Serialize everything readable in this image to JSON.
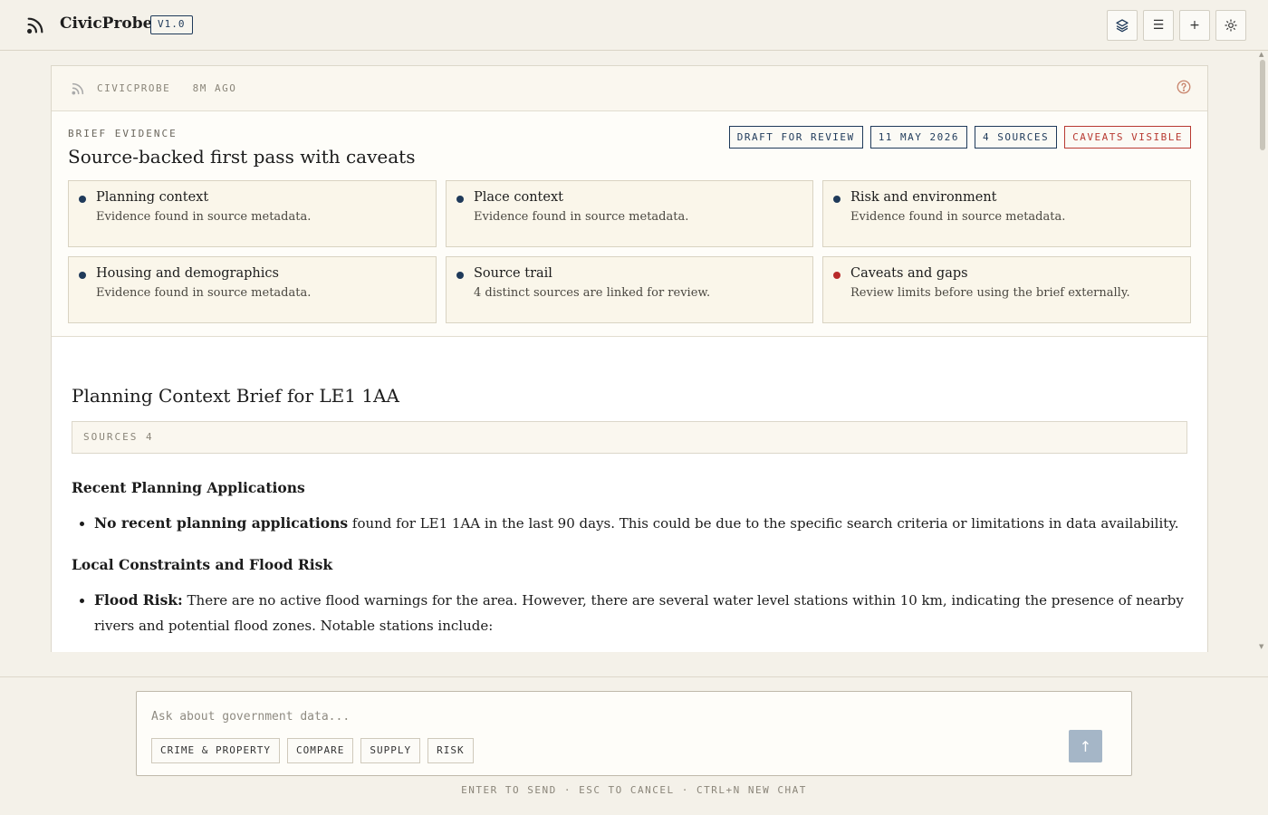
{
  "header": {
    "logo_icon": "rss-feed-icon",
    "app_name": "CivicProbe",
    "version": "V1.0",
    "buttons": [
      {
        "icon": "layers-icon"
      },
      {
        "icon": "menu-icon",
        "glyph": "☰"
      },
      {
        "icon": "plus-icon",
        "glyph": "+"
      },
      {
        "icon": "sun-theme-icon"
      }
    ]
  },
  "panel": {
    "meta": "CIVICPROBE   8M AGO",
    "help_icon": "help-circle-icon"
  },
  "evidence": {
    "label": "BRIEF EVIDENCE",
    "title": "Source-backed first pass with caveats",
    "tags": [
      {
        "label": "DRAFT FOR REVIEW",
        "status": "info"
      },
      {
        "label": "11 MAY 2026",
        "status": "info"
      },
      {
        "label": "4 SOURCES",
        "status": "info"
      },
      {
        "label": "CAVEATS VISIBLE",
        "status": "warn"
      }
    ],
    "cards": [
      {
        "title": "Planning context",
        "sub": "Evidence found in source metadata.",
        "status": "ok"
      },
      {
        "title": "Place context",
        "sub": "Evidence found in source metadata.",
        "status": "ok"
      },
      {
        "title": "Risk and environment",
        "sub": "Evidence found in source metadata.",
        "status": "ok"
      },
      {
        "title": "Housing and demographics",
        "sub": "Evidence found in source metadata.",
        "status": "ok"
      },
      {
        "title": "Source trail",
        "sub": "4 distinct sources are linked for review.",
        "status": "ok"
      },
      {
        "title": "Caveats and gaps",
        "sub": "Review limits before using the brief externally.",
        "status": "warn"
      }
    ]
  },
  "brief": {
    "title": "Planning Context Brief for LE1 1AA",
    "sources": "SOURCES 4",
    "sections": [
      {
        "heading": "Recent Planning Applications",
        "bold": "No recent planning applications",
        "text": " found for LE1 1AA in the last 90 days. This could be due to the specific search criteria or limitations in data availability."
      },
      {
        "heading": "Local Constraints and Flood Risk",
        "bold": "Flood Risk:",
        "text": " There are no active flood warnings for the area. However, there are several water level stations within 10 km, indicating the presence of nearby rivers and potential flood zones. Notable stations include:"
      }
    ]
  },
  "composer": {
    "placeholder": "Ask about government data...",
    "chips": [
      "CRIME & PROPERTY",
      "COMPARE",
      "SUPPLY",
      "RISK"
    ],
    "send_glyph": "↑",
    "hint": "ENTER TO SEND · ESC TO CANCEL · CTRL+N NEW CHAT"
  },
  "colors": {
    "background": "#f4f1e9",
    "accent_navy": "#1f3a5a",
    "warn_red": "#b83a32",
    "send_button": "#a5b6c7"
  }
}
